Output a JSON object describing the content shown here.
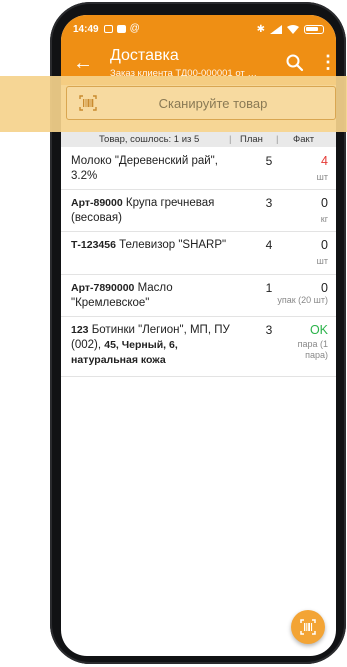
{
  "status_bar": {
    "time": "14:49"
  },
  "app_bar": {
    "back_icon": "arrow-left-icon",
    "title": "Доставка",
    "subtitle": "Заказ клиента ТД00-000001 от 2...",
    "search_icon": "search-icon",
    "more_icon": "more-vertical-icon"
  },
  "scan": {
    "placeholder": "Сканируйте товар",
    "icon": "barcode-icon"
  },
  "table": {
    "columns": {
      "product": "Товар, сошлось: 1 из 5",
      "plan": "План",
      "fact": "Факт"
    },
    "rows": [
      {
        "name": "Молоко \"Деревенский рай\", 3.2%",
        "plan": "5",
        "fact": "4",
        "unit": "шт",
        "fact_color": "#e53935"
      },
      {
        "code": "Арт-89000",
        "name": "Крупа гречневая (весовая)",
        "plan": "3",
        "fact": "0",
        "unit": "кг"
      },
      {
        "code": "Т-123456",
        "name": "Телевизор \"SHARP\"",
        "plan": "4",
        "fact": "0",
        "unit": "шт"
      },
      {
        "code": "Арт-7890000",
        "name": "Масло \"Кремлевское\"",
        "plan": "1",
        "fact": "0",
        "unit": "упак (20 шт)"
      },
      {
        "code": "123",
        "name_part1": "Ботинки \"Легион\", МП, ПУ (002),",
        "name_part2": "45, Черный, 6, натуральная кожа",
        "plan": "3",
        "fact": "OK",
        "unit_line1": "пара (1",
        "unit_line2": "пара)",
        "fact_color": "#2bb34a"
      }
    ]
  },
  "fab": {
    "icon": "barcode-scan-icon"
  },
  "colors": {
    "accent": "#ef8f14",
    "highlight": "#f5d28c"
  }
}
